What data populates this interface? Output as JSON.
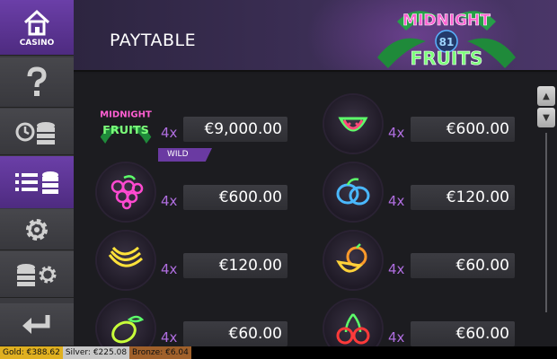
{
  "sidebar": {
    "casino_label": "CASINO"
  },
  "header": {
    "title": "PAYTABLE",
    "logo_top": "MIDNIGHT",
    "logo_number": "81",
    "logo_bottom": "FRUITS"
  },
  "paytable": [
    {
      "symbol": "midnight-fruits-wild",
      "logo_top": "MIDNIGHT",
      "logo_bottom": "FRUITS",
      "multiplier": "4x",
      "payout": "€9,000.00",
      "tag": "WILD"
    },
    {
      "symbol": "watermelon",
      "multiplier": "4x",
      "payout": "€600.00"
    },
    {
      "symbol": "grapes",
      "multiplier": "4x",
      "payout": "€600.00"
    },
    {
      "symbol": "plums",
      "multiplier": "4x",
      "payout": "€120.00"
    },
    {
      "symbol": "banana",
      "multiplier": "4x",
      "payout": "€120.00"
    },
    {
      "symbol": "orange",
      "multiplier": "4x",
      "payout": "€60.00"
    },
    {
      "symbol": "lemon",
      "multiplier": "4x",
      "payout": "€60.00"
    },
    {
      "symbol": "cherries",
      "multiplier": "4x",
      "payout": "€60.00"
    }
  ],
  "status_bar": {
    "gold": "Gold: €388.62",
    "silver": "Silver: €225.08",
    "bronze": "Bronze: €6.04"
  },
  "colors": {
    "accent_purple": "#6b3fa8",
    "multiplier_purple": "#b06ee0"
  }
}
